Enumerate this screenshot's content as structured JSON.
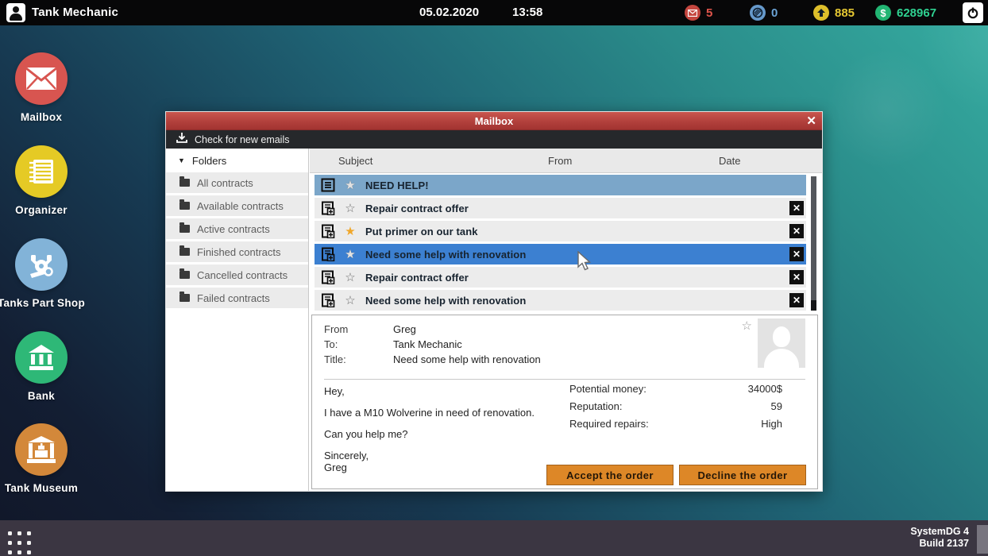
{
  "top_bar": {
    "title": "Tank Mechanic",
    "date": "05.02.2020",
    "time": "13:58",
    "mail_count": "5",
    "parts_count": "0",
    "reputation_count": "885",
    "money_count": "628967",
    "money_symbol": "$"
  },
  "desktop": {
    "icons": [
      {
        "label": "Mailbox"
      },
      {
        "label": "Organizer"
      },
      {
        "label": "Tanks Part Shop"
      },
      {
        "label": "Bank"
      },
      {
        "label": "Tank Museum"
      }
    ]
  },
  "mailbox_window": {
    "title": "Mailbox",
    "close_glyph": "✕",
    "toolbar": {
      "check_label": "Check for new emails"
    },
    "folders": {
      "header": "Folders",
      "items": [
        "All contracts",
        "Available contracts",
        "Active contracts",
        "Finished contracts",
        "Cancelled contracts",
        "Failed contracts"
      ]
    },
    "list": {
      "columns": [
        "Subject",
        "From",
        "Date"
      ],
      "rows": [
        {
          "subject": "NEED HELP!"
        },
        {
          "subject": "Repair contract offer"
        },
        {
          "subject": "Put primer on our tank"
        },
        {
          "subject": "Need some help with renovation"
        },
        {
          "subject": "Repair contract offer"
        },
        {
          "subject": "Need some help with renovation"
        }
      ]
    },
    "detail": {
      "from_label": "From",
      "from_value": "Greg",
      "to_label": "To:",
      "to_value": "Tank Mechanic",
      "title_label": "Title:",
      "title_value": "Need some help with renovation",
      "body": [
        "Hey,",
        "I have a M10 Wolverine in need of renovation.",
        "Can you help me?",
        "Sincerely,\nGreg"
      ],
      "stats": [
        {
          "label": "Potential money:",
          "value": "34000$"
        },
        {
          "label": "Reputation:",
          "value": "59"
        },
        {
          "label": "Required repairs:",
          "value": "High"
        }
      ],
      "accept_label": "Accept the order",
      "decline_label": "Decline the order"
    }
  },
  "taskbar": {
    "system": "SystemDG 4",
    "build": "Build 2137"
  },
  "colors": {
    "titlebar_red": "#b2403c",
    "selected_row_blue": "#3c80d1",
    "highlight_row_blue": "#7ba6c9",
    "button_orange": "#dd8727",
    "money_green": "#2fd191",
    "reputation_yellow": "#e6c832",
    "mail_red": "#e0544b",
    "parts_blue": "#6ba3d6"
  }
}
